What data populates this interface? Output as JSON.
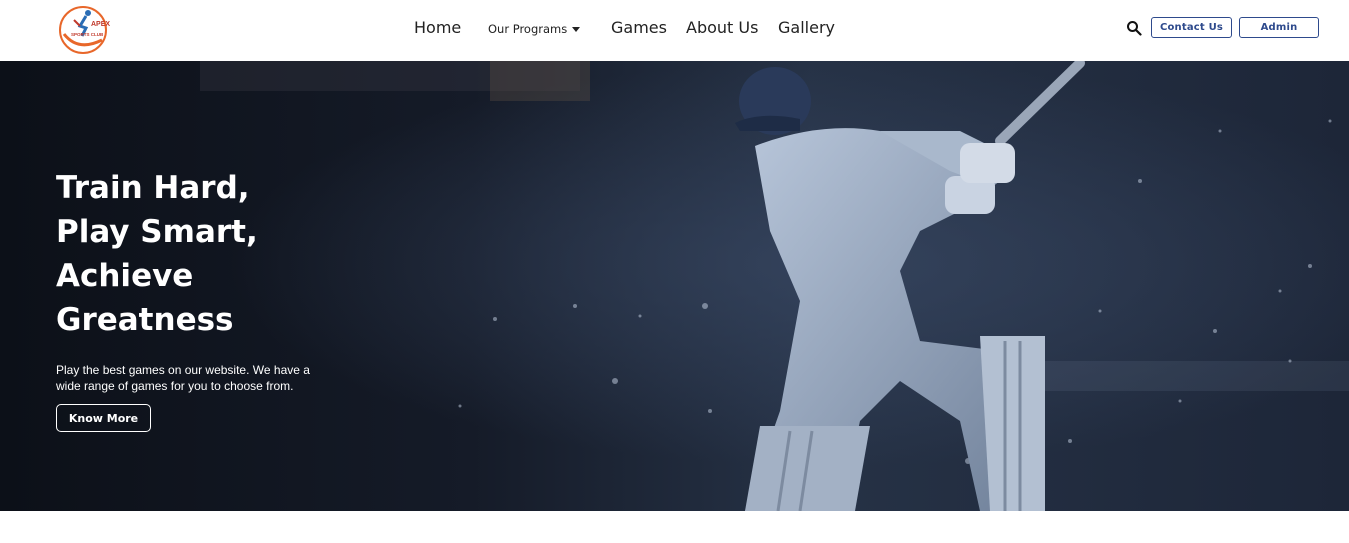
{
  "logo": {
    "line1": "APEX",
    "line2": "SPORTS CLUB"
  },
  "nav": {
    "items": [
      {
        "label": "Home"
      },
      {
        "label": "Our Programs"
      },
      {
        "label": "Games"
      },
      {
        "label": "About Us"
      },
      {
        "label": "Gallery"
      }
    ],
    "contact_label": "Contact Us",
    "admin_label": "Admin"
  },
  "hero": {
    "headline": [
      "Train Hard,",
      "Play Smart,",
      "Achieve",
      "Greatness"
    ],
    "subtext": "Play the best games on our website. We have a wide range of games for you to choose from.",
    "cta_label": "Know More"
  },
  "colors": {
    "accent": "#2e4a8c",
    "hero_bg": "#1a2030",
    "logo_orange": "#e8672a"
  }
}
